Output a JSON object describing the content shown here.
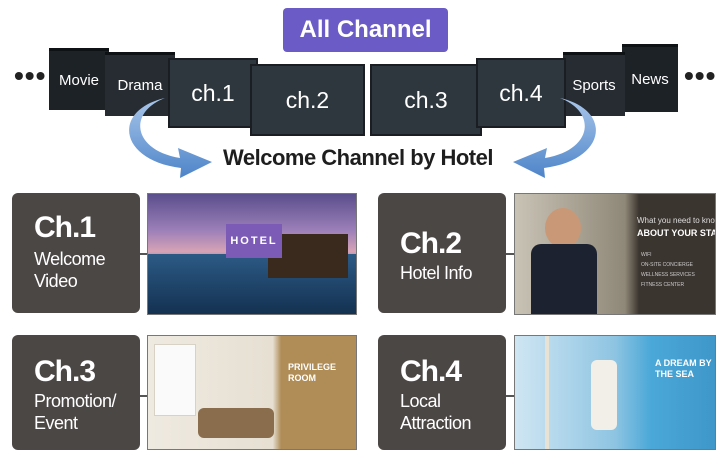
{
  "header": {
    "title": "All Channel"
  },
  "channel_strip": {
    "ellipsis_left": "•••",
    "ellipsis_right": "•••",
    "items": [
      "Movie",
      "Drama",
      "ch.1",
      "ch.2",
      "ch.3",
      "ch.4",
      "Sports",
      "News"
    ]
  },
  "welcome_label": "Welcome Channel by Hotel",
  "cards": [
    {
      "channel": "Ch.1",
      "desc_line1": "Welcome",
      "desc_line2": "Video",
      "screen": {
        "line1": "HOTEL",
        "line2": "",
        "accent": "#7b5bb6"
      }
    },
    {
      "channel": "Ch.2",
      "desc_line1": "Hotel Info",
      "desc_line2": "",
      "screen": {
        "line1": "What you need to know",
        "line2": "ABOUT YOUR STAY",
        "bullets": [
          "WIFI",
          "ON-SITE CONCIERGE",
          "WELLNESS SERVICES",
          "FITNESS CENTER"
        ]
      }
    },
    {
      "channel": "Ch.3",
      "desc_line1": "Promotion/",
      "desc_line2": "Event",
      "screen": {
        "line1": "PRIVILEGE",
        "line2": "ROOM",
        "accent": "#b08d57"
      }
    },
    {
      "channel": "Ch.4",
      "desc_line1": "Local",
      "desc_line2": "Attraction",
      "screen": {
        "line1": "A DREAM BY",
        "line2": "THE SEA",
        "accent": "#4aa8d8"
      }
    }
  ],
  "colors": {
    "pill": "#6a5bc7",
    "card": "#4b4745",
    "arrow": "#5b8fd0"
  }
}
